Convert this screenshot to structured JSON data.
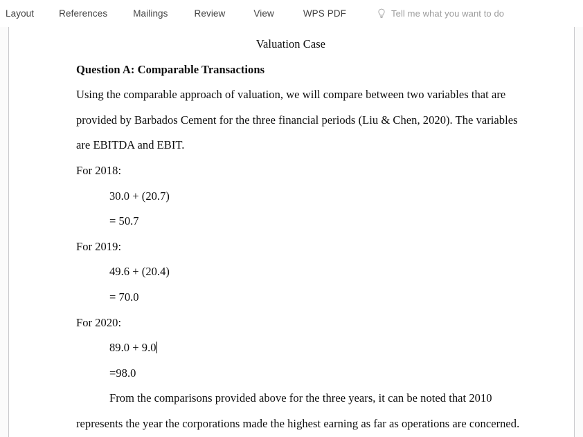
{
  "ribbon": {
    "tabs": [
      {
        "id": "layout",
        "label": "Layout"
      },
      {
        "id": "references",
        "label": "References"
      },
      {
        "id": "mailings",
        "label": "Mailings"
      },
      {
        "id": "review",
        "label": "Review"
      },
      {
        "id": "view",
        "label": "View"
      },
      {
        "id": "wpspdf",
        "label": "WPS PDF"
      }
    ],
    "tell_me": {
      "icon": "lightbulb-icon",
      "label": "Tell me what you want to do"
    },
    "colors": {
      "tab_text": "#444444",
      "tell_me_text": "#9b9b9b",
      "page_edge": "#c9c9cc"
    }
  },
  "document": {
    "title": "Valuation Case",
    "heading": "Question A: Comparable Transactions",
    "paragraph_intro": [
      "Using the comparable approach of valuation, we will compare between two variables that are",
      "provided by Barbados Cement for the three financial periods (Liu & Chen, 2020). The variables",
      "are EBITDA and EBIT."
    ],
    "years": [
      {
        "label": "For 2018:",
        "expression": "30.0 + (20.7)",
        "result": "= 50.7"
      },
      {
        "label": "For 2019:",
        "expression": "49.6 + (20.4)",
        "result": "= 70.0"
      },
      {
        "label": "For 2020:",
        "expression": "89.0 + 9.0",
        "result": "=98.0"
      }
    ],
    "paragraph_closing": [
      "From the comparisons provided above for the three years, it can be noted that 2010",
      "represents the year the corporations made the highest earning as far as operations are concerned."
    ],
    "caret": {
      "visible": true,
      "after_text": "89.0 + 9.0"
    }
  }
}
